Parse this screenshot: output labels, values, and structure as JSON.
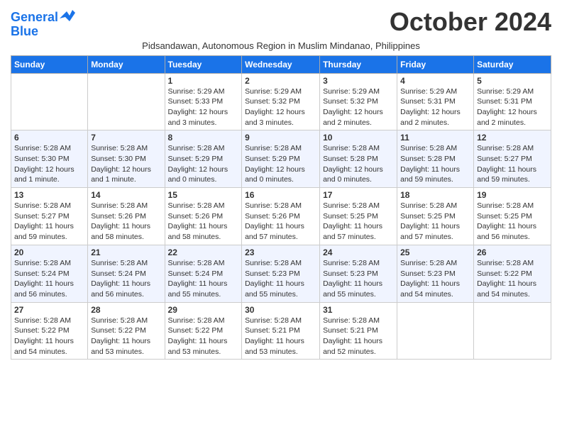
{
  "logo": {
    "line1": "General",
    "line2": "Blue"
  },
  "title": "October 2024",
  "subtitle": "Pidsandawan, Autonomous Region in Muslim Mindanao, Philippines",
  "days_of_week": [
    "Sunday",
    "Monday",
    "Tuesday",
    "Wednesday",
    "Thursday",
    "Friday",
    "Saturday"
  ],
  "weeks": [
    [
      {
        "day": "",
        "info": ""
      },
      {
        "day": "",
        "info": ""
      },
      {
        "day": "1",
        "info": "Sunrise: 5:29 AM\nSunset: 5:33 PM\nDaylight: 12 hours\nand 3 minutes."
      },
      {
        "day": "2",
        "info": "Sunrise: 5:29 AM\nSunset: 5:32 PM\nDaylight: 12 hours\nand 3 minutes."
      },
      {
        "day": "3",
        "info": "Sunrise: 5:29 AM\nSunset: 5:32 PM\nDaylight: 12 hours\nand 2 minutes."
      },
      {
        "day": "4",
        "info": "Sunrise: 5:29 AM\nSunset: 5:31 PM\nDaylight: 12 hours\nand 2 minutes."
      },
      {
        "day": "5",
        "info": "Sunrise: 5:29 AM\nSunset: 5:31 PM\nDaylight: 12 hours\nand 2 minutes."
      }
    ],
    [
      {
        "day": "6",
        "info": "Sunrise: 5:28 AM\nSunset: 5:30 PM\nDaylight: 12 hours\nand 1 minute."
      },
      {
        "day": "7",
        "info": "Sunrise: 5:28 AM\nSunset: 5:30 PM\nDaylight: 12 hours\nand 1 minute."
      },
      {
        "day": "8",
        "info": "Sunrise: 5:28 AM\nSunset: 5:29 PM\nDaylight: 12 hours\nand 0 minutes."
      },
      {
        "day": "9",
        "info": "Sunrise: 5:28 AM\nSunset: 5:29 PM\nDaylight: 12 hours\nand 0 minutes."
      },
      {
        "day": "10",
        "info": "Sunrise: 5:28 AM\nSunset: 5:28 PM\nDaylight: 12 hours\nand 0 minutes."
      },
      {
        "day": "11",
        "info": "Sunrise: 5:28 AM\nSunset: 5:28 PM\nDaylight: 11 hours\nand 59 minutes."
      },
      {
        "day": "12",
        "info": "Sunrise: 5:28 AM\nSunset: 5:27 PM\nDaylight: 11 hours\nand 59 minutes."
      }
    ],
    [
      {
        "day": "13",
        "info": "Sunrise: 5:28 AM\nSunset: 5:27 PM\nDaylight: 11 hours\nand 59 minutes."
      },
      {
        "day": "14",
        "info": "Sunrise: 5:28 AM\nSunset: 5:26 PM\nDaylight: 11 hours\nand 58 minutes."
      },
      {
        "day": "15",
        "info": "Sunrise: 5:28 AM\nSunset: 5:26 PM\nDaylight: 11 hours\nand 58 minutes."
      },
      {
        "day": "16",
        "info": "Sunrise: 5:28 AM\nSunset: 5:26 PM\nDaylight: 11 hours\nand 57 minutes."
      },
      {
        "day": "17",
        "info": "Sunrise: 5:28 AM\nSunset: 5:25 PM\nDaylight: 11 hours\nand 57 minutes."
      },
      {
        "day": "18",
        "info": "Sunrise: 5:28 AM\nSunset: 5:25 PM\nDaylight: 11 hours\nand 57 minutes."
      },
      {
        "day": "19",
        "info": "Sunrise: 5:28 AM\nSunset: 5:25 PM\nDaylight: 11 hours\nand 56 minutes."
      }
    ],
    [
      {
        "day": "20",
        "info": "Sunrise: 5:28 AM\nSunset: 5:24 PM\nDaylight: 11 hours\nand 56 minutes."
      },
      {
        "day": "21",
        "info": "Sunrise: 5:28 AM\nSunset: 5:24 PM\nDaylight: 11 hours\nand 56 minutes."
      },
      {
        "day": "22",
        "info": "Sunrise: 5:28 AM\nSunset: 5:24 PM\nDaylight: 11 hours\nand 55 minutes."
      },
      {
        "day": "23",
        "info": "Sunrise: 5:28 AM\nSunset: 5:23 PM\nDaylight: 11 hours\nand 55 minutes."
      },
      {
        "day": "24",
        "info": "Sunrise: 5:28 AM\nSunset: 5:23 PM\nDaylight: 11 hours\nand 55 minutes."
      },
      {
        "day": "25",
        "info": "Sunrise: 5:28 AM\nSunset: 5:23 PM\nDaylight: 11 hours\nand 54 minutes."
      },
      {
        "day": "26",
        "info": "Sunrise: 5:28 AM\nSunset: 5:22 PM\nDaylight: 11 hours\nand 54 minutes."
      }
    ],
    [
      {
        "day": "27",
        "info": "Sunrise: 5:28 AM\nSunset: 5:22 PM\nDaylight: 11 hours\nand 54 minutes."
      },
      {
        "day": "28",
        "info": "Sunrise: 5:28 AM\nSunset: 5:22 PM\nDaylight: 11 hours\nand 53 minutes."
      },
      {
        "day": "29",
        "info": "Sunrise: 5:28 AM\nSunset: 5:22 PM\nDaylight: 11 hours\nand 53 minutes."
      },
      {
        "day": "30",
        "info": "Sunrise: 5:28 AM\nSunset: 5:21 PM\nDaylight: 11 hours\nand 53 minutes."
      },
      {
        "day": "31",
        "info": "Sunrise: 5:28 AM\nSunset: 5:21 PM\nDaylight: 11 hours\nand 52 minutes."
      },
      {
        "day": "",
        "info": ""
      },
      {
        "day": "",
        "info": ""
      }
    ]
  ]
}
